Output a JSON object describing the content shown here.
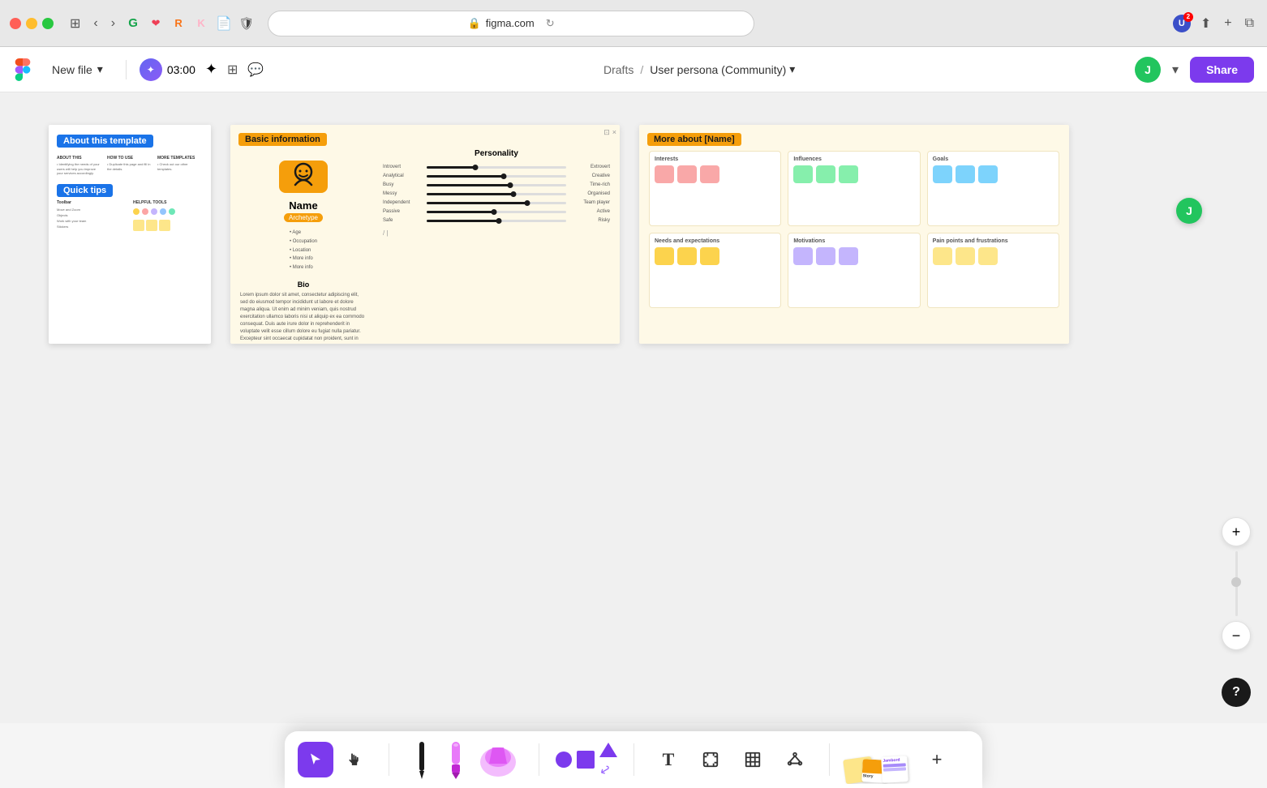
{
  "browser": {
    "url": "figma.com",
    "lock_icon": "🔒"
  },
  "toolbar": {
    "new_file_label": "New file",
    "drafts_label": "Drafts",
    "file_title": "User persona (Community)",
    "share_label": "Share",
    "timer": "03:00",
    "user_initial": "J"
  },
  "canvas": {
    "frames": [
      {
        "id": "about",
        "label": "About this template",
        "sublabel": "Quick tips"
      },
      {
        "id": "basic",
        "label": "Basic information",
        "persona_name": "Name",
        "persona_tag": "Archetype",
        "bio_title": "Bio",
        "bio_text": "Lorem ipsum dolor sit amet, consectetur adipiscing elit, sed do eiusmod tempor incididunt ut labore et dolore magna aliqua. Ut enim ad minim veniam, quis nostrud exercitation ullamco laboris nisi ut aliquip ex ea commodo consequat. Duis aute irure dolor in reprehenderit in voluptate velit esse cillum dolore eu fugiat nulla pariatur. Excepteur sint occaecat cupidatat non proident, sunt in culpa qui officia deserunt mollit anim id est laborum.",
        "personality_title": "Personality",
        "sliders": [
          {
            "left": "Introvert",
            "right": "Extrovert",
            "position": 35
          },
          {
            "left": "Analytical",
            "right": "Creative",
            "position": 55
          },
          {
            "left": "Busy",
            "right": "Time-rich",
            "position": 60
          },
          {
            "left": "Messy",
            "right": "Organised",
            "position": 62
          },
          {
            "left": "Independent",
            "right": "Team player",
            "position": 72
          },
          {
            "left": "Passive",
            "right": "Active",
            "position": 48
          },
          {
            "left": "Safe",
            "right": "Risky",
            "position": 52
          }
        ],
        "buttons": [
          "···",
          "···",
          "···"
        ]
      },
      {
        "id": "more",
        "label": "More about [Name]",
        "sections": [
          {
            "title": "Interests",
            "color_type": "pink"
          },
          {
            "title": "Influences",
            "color_type": "green"
          },
          {
            "title": "Goals",
            "color_type": "blue"
          },
          {
            "title": "Needs and expectations",
            "color_type": "orange"
          },
          {
            "title": "Motivations",
            "color_type": "purple"
          },
          {
            "title": "Pain points and frustrations",
            "color_type": "yellow"
          }
        ]
      }
    ]
  },
  "bottom_toolbar": {
    "tools": [
      {
        "name": "cursor",
        "label": "▶",
        "active": true
      },
      {
        "name": "hand",
        "label": "✋",
        "active": false
      },
      {
        "name": "pen",
        "label": "✏️",
        "active": false
      }
    ],
    "add_icon": "+"
  },
  "zoom": {
    "plus_label": "+",
    "minus_label": "−"
  },
  "help": {
    "label": "?"
  }
}
